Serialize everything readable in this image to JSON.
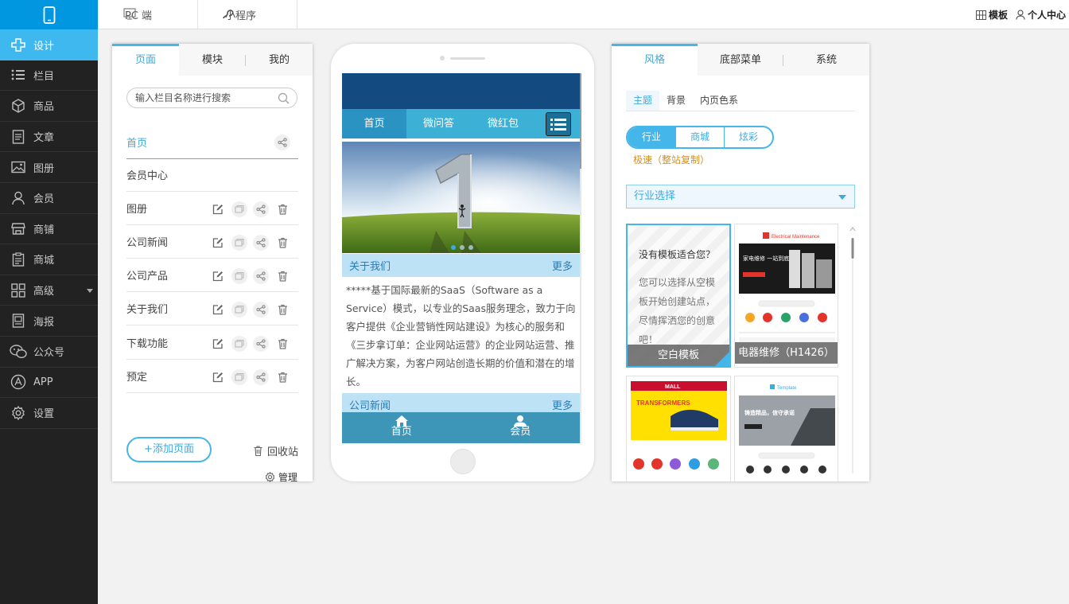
{
  "sidebar": {
    "logo_icon": "mobile-phone-icon",
    "items": [
      {
        "label": "设计",
        "icon": "design-icon",
        "active": true
      },
      {
        "label": "栏目",
        "icon": "list-icon"
      },
      {
        "label": "商品",
        "icon": "box-icon"
      },
      {
        "label": "文章",
        "icon": "article-icon"
      },
      {
        "label": "图册",
        "icon": "image-icon"
      },
      {
        "label": "会员",
        "icon": "user-icon"
      },
      {
        "label": "商铺",
        "icon": "shop-icon"
      },
      {
        "label": "商城",
        "icon": "clipboard-icon"
      },
      {
        "label": "高级",
        "icon": "grid-icon",
        "has_arrow": true
      },
      {
        "label": "海报",
        "icon": "poster-icon"
      },
      {
        "label": "公众号",
        "icon": "wechat-icon"
      },
      {
        "label": "APP",
        "icon": "app-icon"
      },
      {
        "label": "设置",
        "icon": "gear-icon"
      }
    ]
  },
  "topbar": {
    "tabs": [
      {
        "label": "PC 端",
        "icon": "monitor-icon"
      },
      {
        "label": "小程序",
        "icon": "miniprogram-icon"
      }
    ],
    "template_label": "模板",
    "account_label": "个人中心"
  },
  "left_panel": {
    "tabs": [
      "页面",
      "模块",
      "我的"
    ],
    "search_placeholder": "输入栏目名称进行搜索",
    "pages": [
      {
        "name": "首页",
        "active": true
      },
      {
        "name": "会员中心"
      },
      {
        "name": "图册"
      },
      {
        "name": "公司新闻"
      },
      {
        "name": "公司产品"
      },
      {
        "name": "关于我们"
      },
      {
        "name": "下载功能"
      },
      {
        "name": "预定"
      }
    ],
    "add_page_label": "+添加页面",
    "recycle_label": "回收站",
    "manage_label": "管理"
  },
  "phone": {
    "nav": [
      "首页",
      "微问答",
      "微红包"
    ],
    "about_title": "关于我们",
    "more_label": "更多",
    "about_text": "*****基于国际最新的SaaS（Software as a Service）模式，以专业的Saas服务理念，致力于向客户提供《企业营销性网站建设》为核心的服务和《三步拿订单：企业网站运营》的企业网站运营、推广解决方案，为客户网站创造长期的价值和潜在的增长。",
    "news_title": "公司新闻",
    "news_more": "更多",
    "footer": [
      {
        "label": "首页",
        "icon": "home-icon"
      },
      {
        "label": "会员",
        "icon": "member-icon"
      }
    ]
  },
  "right_panel": {
    "tabs": [
      "风格",
      "底部菜单",
      "系统"
    ],
    "subtabs": [
      "主题",
      "背景",
      "内页色系"
    ],
    "segments": [
      "行业",
      "商城",
      "炫彩"
    ],
    "copy_hint": "极速（整站复制）",
    "industry_select": "行业选择",
    "blank_template": {
      "question": "没有模板适合您？",
      "desc": "您可以选择从空模板开始创建站点，尽情挥洒您的创意吧！",
      "label": "空白模板"
    },
    "templates": [
      {
        "label": "电器维修（H1426）",
        "brand": "Electrical Maintenance",
        "banner_text": "家电维修 一站到底"
      },
      {
        "brand": "MALL",
        "banner_text": "TRANSFORMERS"
      },
      {
        "brand": "Template",
        "banner_text": "铸造精品，信守承诺"
      }
    ]
  },
  "colors": {
    "accent": "#45b6ea",
    "sidebar_bg": "#222222",
    "sidebar_active": "#3fb8ef",
    "logo_bg": "#0097e0",
    "phone_header": "#134a80",
    "phone_nav": "#3db0d6",
    "hint_orange": "#d58f1e"
  }
}
